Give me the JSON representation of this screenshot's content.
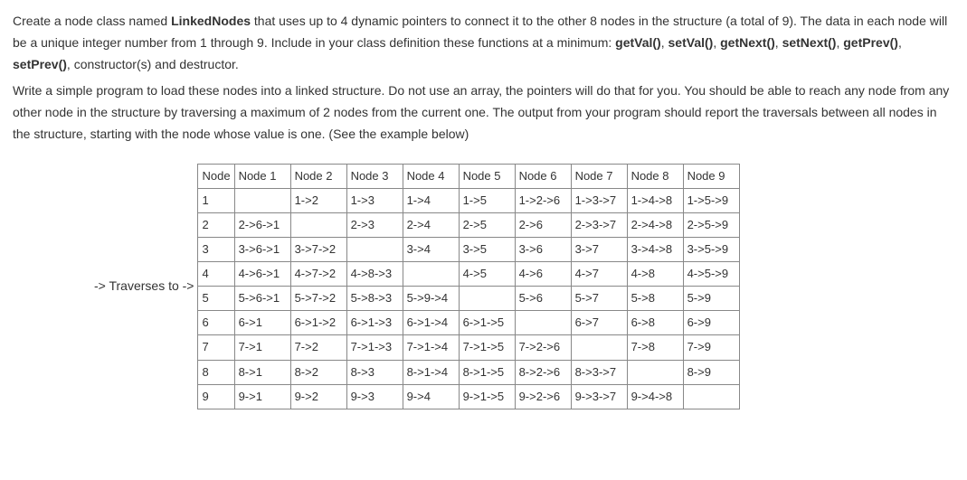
{
  "para1": {
    "t1": "Create a node class named ",
    "b1": "LinkedNodes",
    "t2": " that uses up to 4 dynamic pointers to connect it to the other 8 nodes in the structure (a total of 9). The data in each node will be a unique integer number from 1 through 9. Include in your class definition these functions at a minimum: ",
    "f1": "getVal()",
    "c1": ", ",
    "f2": "setVal()",
    "c2": ", ",
    "f3": "getNext()",
    "c3": ", ",
    "f4": "setNext()",
    "c4": ", ",
    "f5": "getPrev()",
    "c5": ", ",
    "f6": "setPrev()",
    "c6": ", constructor(s) and destructor."
  },
  "para2": "Write a simple program to load these nodes into a linked structure. Do not use an array, the pointers will do that for you. You should be able to reach any node from any other node in the structure by traversing a maximum of 2 nodes from the current one. The output from your program should report the traversals between all nodes in the structure, starting with the node whose value is one. (See the example below)",
  "traversesLabel": "-> Traverses to ->",
  "table": {
    "headers": [
      "Node",
      "Node 1",
      "Node 2",
      "Node 3",
      "Node 4",
      "Node 5",
      "Node 6",
      "Node 7",
      "Node 8",
      "Node 9"
    ],
    "rows": [
      [
        "1",
        "",
        "1->2",
        "1->3",
        "1->4",
        "1->5",
        "1->2->6",
        "1->3->7",
        "1->4->8",
        "1->5->9"
      ],
      [
        "2",
        "2->6->1",
        "",
        "2->3",
        "2->4",
        "2->5",
        "2->6",
        "2->3->7",
        "2->4->8",
        "2->5->9"
      ],
      [
        "3",
        "3->6->1",
        "3->7->2",
        "",
        "3->4",
        "3->5",
        "3->6",
        "3->7",
        "3->4->8",
        "3->5->9"
      ],
      [
        "4",
        "4->6->1",
        "4->7->2",
        "4->8->3",
        "",
        "4->5",
        "4->6",
        "4->7",
        "4->8",
        "4->5->9"
      ],
      [
        "5",
        "5->6->1",
        "5->7->2",
        "5->8->3",
        "5->9->4",
        "",
        "5->6",
        "5->7",
        "5->8",
        "5->9"
      ],
      [
        "6",
        "6->1",
        "6->1->2",
        "6->1->3",
        "6->1->4",
        "6->1->5",
        "",
        "6->7",
        "6->8",
        "6->9"
      ],
      [
        "7",
        "7->1",
        "7->2",
        "7->1->3",
        "7->1->4",
        "7->1->5",
        "7->2->6",
        "",
        "7->8",
        "7->9"
      ],
      [
        "8",
        "8->1",
        "8->2",
        "8->3",
        "8->1->4",
        "8->1->5",
        "8->2->6",
        "8->3->7",
        "",
        "8->9"
      ],
      [
        "9",
        "9->1",
        "9->2",
        "9->3",
        "9->4",
        "9->1->5",
        "9->2->6",
        "9->3->7",
        "9->4->8",
        ""
      ]
    ]
  }
}
